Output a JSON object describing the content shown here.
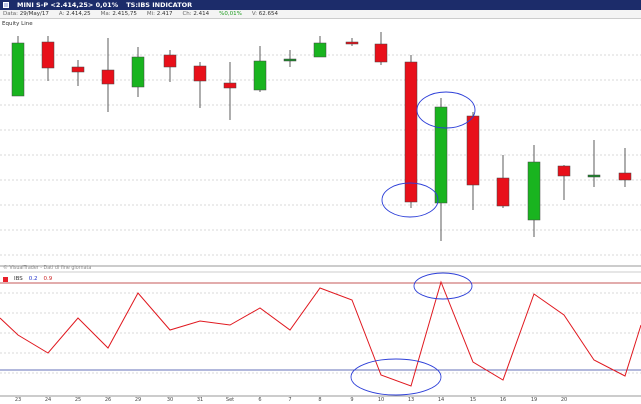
{
  "header": {
    "title": "MINI S-P <2.414,25> 0,01%",
    "indicator": "TS:IBS INDICATOR"
  },
  "info": {
    "date_label": "Data:",
    "date": "29/May/17",
    "open_label": "A:",
    "open": "2.414,25",
    "high_label": "Ma:",
    "high": "2.415,75",
    "low_label": "Mi:",
    "low": "2.417",
    "close_label": "Ch:",
    "close": "2.414",
    "pct": "%0,01%",
    "vol_label": "V:",
    "vol": "62.654"
  },
  "equity_label": "Equity Line",
  "watermark": "© VisualTrader - Dati di fine giornata",
  "rsi_header": {
    "name": "IBS",
    "level_low": "0.2",
    "level_high": "0.9"
  },
  "x_labels": [
    "23",
    "24",
    "25",
    "26",
    "29",
    "30",
    "31",
    "Set",
    "6",
    "7",
    "8",
    "9",
    "10",
    "13",
    "14",
    "15",
    "16",
    "19",
    "20"
  ],
  "colors": {
    "up": "#19b41f",
    "down": "#e8101a",
    "line": "#e0181f",
    "level_high": "#b02020",
    "level_low": "#3040a0",
    "annot": "#2c3ed8",
    "grid": "#b4b4b4"
  },
  "chart_data": {
    "type": "candlestick",
    "candles": [
      {
        "x": "23",
        "open": 96,
        "close": 43,
        "high": 36,
        "low": 56,
        "dir": "up"
      },
      {
        "x": "24",
        "open": 42,
        "close": 68,
        "high": 36,
        "low": 81,
        "dir": "down"
      },
      {
        "x": "25",
        "open": 67,
        "close": 72,
        "high": 60,
        "low": 86,
        "dir": "down"
      },
      {
        "x": "26",
        "open": 70,
        "close": 84,
        "high": 38,
        "low": 112,
        "dir": "down"
      },
      {
        "x": "29",
        "open": 87,
        "close": 57,
        "high": 47,
        "low": 97,
        "dir": "up"
      },
      {
        "x": "30",
        "open": 55,
        "close": 67,
        "high": 50,
        "low": 82,
        "dir": "down"
      },
      {
        "x": "31",
        "open": 66,
        "close": 81,
        "high": 62,
        "low": 108,
        "dir": "down"
      },
      {
        "x": "Set",
        "open": 83,
        "close": 88,
        "high": 62,
        "low": 120,
        "dir": "down"
      },
      {
        "x": "6",
        "open": 90,
        "close": 61,
        "high": 46,
        "low": 92,
        "dir": "up"
      },
      {
        "x": "7",
        "open": 59,
        "close": 60,
        "high": 50,
        "low": 67,
        "dir": "flat"
      },
      {
        "x": "8",
        "open": 57,
        "close": 43,
        "high": 36,
        "low": 57,
        "dir": "up"
      },
      {
        "x": "9",
        "open": 42,
        "close": 44,
        "high": 38,
        "low": 46,
        "dir": "down"
      },
      {
        "x": "10",
        "open": 44,
        "close": 62,
        "high": 32,
        "low": 65,
        "dir": "down"
      },
      {
        "x": "13",
        "open": 62,
        "close": 202,
        "high": 55,
        "low": 208,
        "dir": "down"
      },
      {
        "x": "14",
        "open": 203,
        "close": 107,
        "high": 98,
        "low": 241,
        "dir": "up"
      },
      {
        "x": "15",
        "open": 116,
        "close": 185,
        "high": 112,
        "low": 210,
        "dir": "down"
      },
      {
        "x": "16",
        "open": 178,
        "close": 206,
        "high": 155,
        "low": 208,
        "dir": "down"
      },
      {
        "x": "17",
        "open": 220,
        "close": 162,
        "high": 145,
        "low": 237,
        "dir": "up"
      },
      {
        "x": "18",
        "open": 166,
        "close": 176,
        "high": 165,
        "low": 200,
        "dir": "down"
      },
      {
        "x": "19",
        "open": 175,
        "close": 177,
        "high": 140,
        "low": 187,
        "dir": "flat"
      },
      {
        "x": "20",
        "open": 173,
        "close": 180,
        "high": 148,
        "low": 187,
        "dir": "down"
      }
    ],
    "ibs_series": [
      318,
      333,
      353,
      318,
      348,
      293,
      330,
      321,
      325,
      308,
      330,
      288,
      300,
      375,
      386,
      282,
      362,
      380,
      294,
      315,
      360,
      376,
      325
    ],
    "ibs_levels": {
      "high": 0.9,
      "low": 0.2
    }
  }
}
